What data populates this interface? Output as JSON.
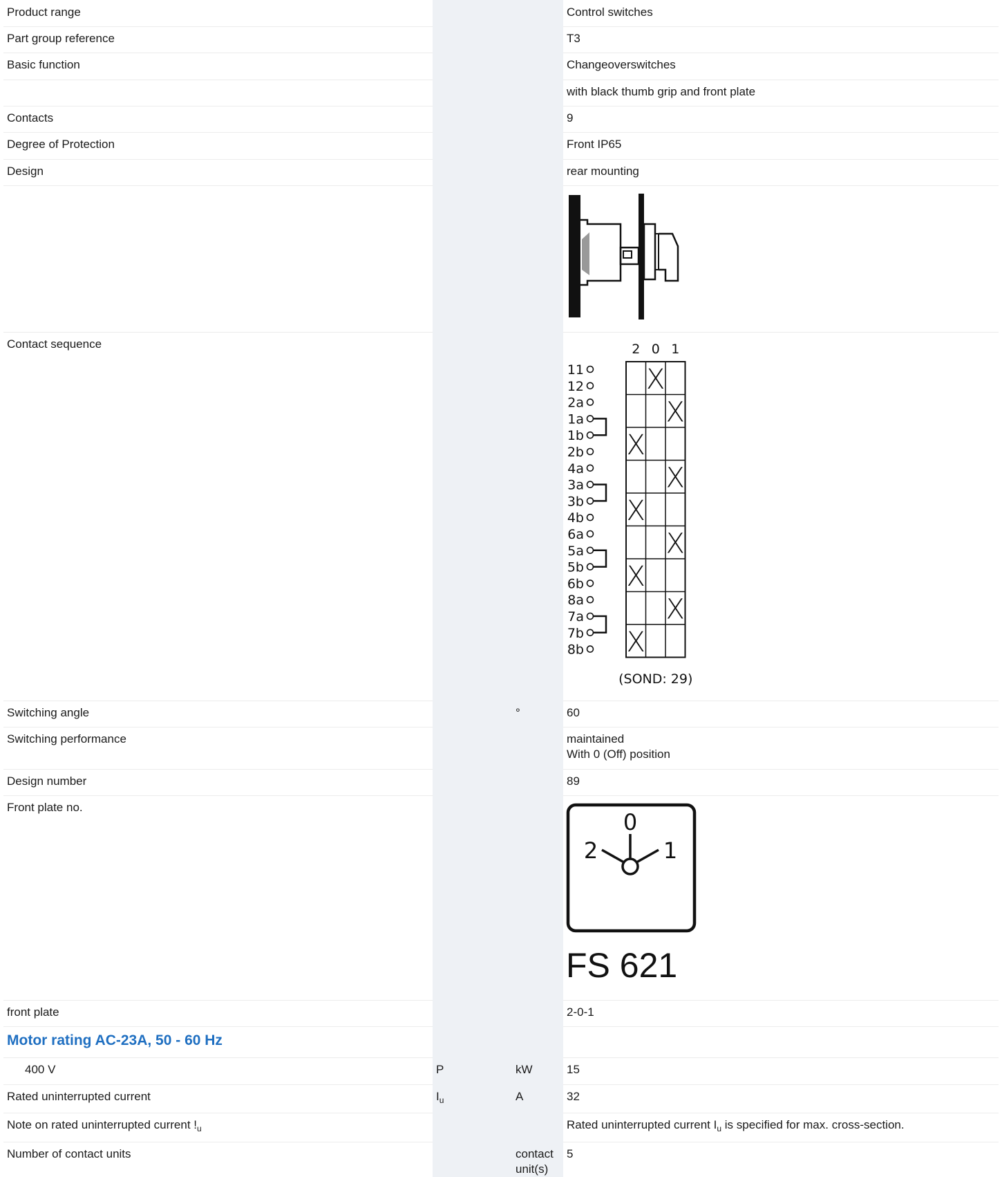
{
  "rows": [
    {
      "label": "Product range",
      "value": "Control switches"
    },
    {
      "label": "Part group reference",
      "value": "T3"
    },
    {
      "label": "Basic function",
      "value": "Changeoverswitches"
    },
    {
      "label": "",
      "value": "with black thumb grip and front plate"
    },
    {
      "label": "Contacts",
      "value": "9"
    },
    {
      "label": "Degree of Protection",
      "value": "Front IP65"
    },
    {
      "label": "Design",
      "value": "rear mounting"
    },
    {
      "label": "Contact sequence"
    },
    {
      "label": "Switching angle",
      "unit": "°",
      "value": "60"
    },
    {
      "label": "Switching performance",
      "value_line1": "maintained",
      "value_line2": "With 0 (Off) position"
    },
    {
      "label": "Design number",
      "value": "89"
    },
    {
      "label": "Front plate no."
    },
    {
      "label": "front plate",
      "value": "2-0-1"
    }
  ],
  "section": {
    "title": "Motor rating AC-23A, 50 - 60 Hz"
  },
  "motor": {
    "label": "400 V",
    "symbol": "P",
    "unit": "kW",
    "value": "15"
  },
  "rated_current": {
    "label": "Rated uninterrupted current",
    "symbol": "I",
    "symbol_sub": "u",
    "unit": "A",
    "value": "32"
  },
  "note": {
    "label": "Note on rated uninterrupted current !",
    "label_sub": "u",
    "value_pre": "Rated uninterrupted current I",
    "value_sub": "u",
    "value_post": " is specified for max. cross-section."
  },
  "contact_units": {
    "label": "Number of contact units",
    "unit_line1": "contact",
    "unit_line2": "unit(s)",
    "value": "5"
  },
  "contact_diagram": {
    "positions": [
      "2",
      "0",
      "1"
    ],
    "terminals": [
      "11",
      "12",
      "2a",
      "1a",
      "1b",
      "2b",
      "4a",
      "3a",
      "3b",
      "4b",
      "6a",
      "5a",
      "5b",
      "6b",
      "8a",
      "7a",
      "7b",
      "8b"
    ],
    "closed": [
      {
        "row": 1,
        "pos": "0"
      },
      {
        "row": 2,
        "pos": "1"
      },
      {
        "row": 3,
        "pos": "2"
      },
      {
        "row": 4,
        "pos": "1"
      },
      {
        "row": 5,
        "pos": "2"
      },
      {
        "row": 6,
        "pos": "1"
      },
      {
        "row": 7,
        "pos": "2"
      },
      {
        "row": 8,
        "pos": "1"
      },
      {
        "row": 9,
        "pos": "2"
      }
    ],
    "caption": "(SOND: 29)"
  },
  "front_plate_symbol": {
    "labels": [
      "0",
      "2",
      "1"
    ],
    "code": "FS 621"
  }
}
